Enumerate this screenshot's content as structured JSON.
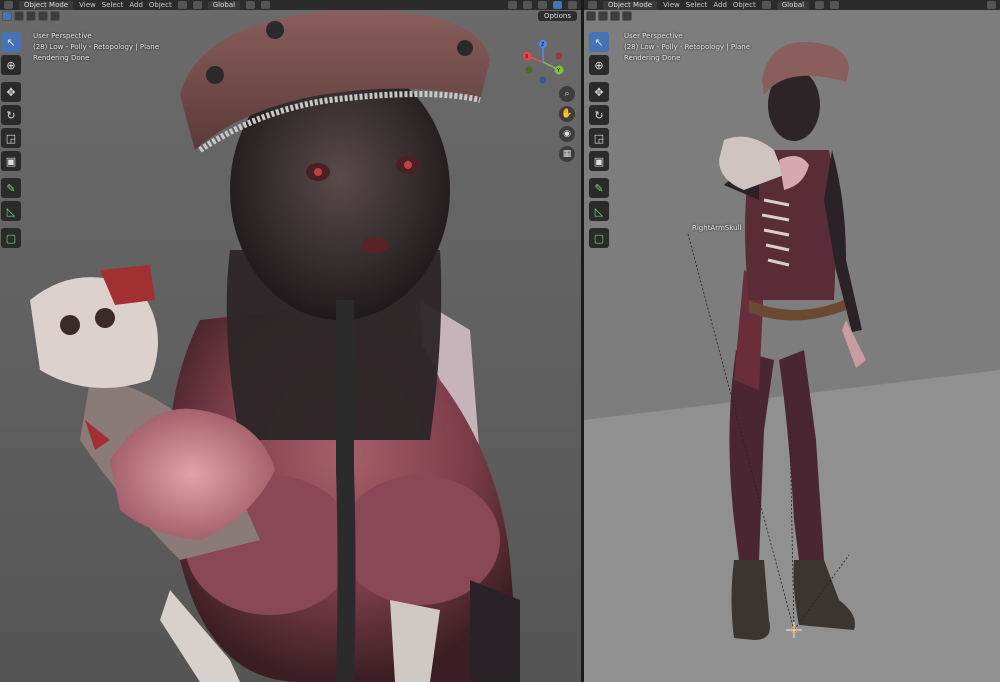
{
  "left_viewport": {
    "header": {
      "mode": "Object Mode",
      "menus": [
        "View",
        "Select",
        "Add",
        "Object"
      ],
      "transform": "Global"
    },
    "options_label": "Options",
    "overlay": {
      "perspective": "User Perspective",
      "object": "(28) Low - Polly - Retopology | Plane",
      "status": "Rendering Done"
    },
    "gizmo": {
      "axes": [
        "X",
        "Y",
        "Z"
      ],
      "colors": {
        "x": "#e34b4b",
        "y": "#7fc241",
        "z": "#4a8ef0"
      }
    },
    "nav_icons": [
      "zoom-icon",
      "hand-icon",
      "camera-icon",
      "grid-icon"
    ]
  },
  "right_viewport": {
    "header": {
      "mode": "Object Mode",
      "menus": [
        "View",
        "Select",
        "Add",
        "Object"
      ],
      "transform": "Global"
    },
    "overlay": {
      "perspective": "User Perspective",
      "object": "(28) Low - Polly - Retopology | Plane",
      "status": "Rendering Done"
    },
    "object_label": "RightArmSkull"
  },
  "toolbar_icons": [
    "cursor-select-icon",
    "cursor-3d-icon",
    "move-icon",
    "rotate-icon",
    "scale-icon",
    "transform-icon",
    "annotate-icon",
    "measure-icon",
    "add-cube-icon"
  ],
  "colors": {
    "accent": "#4772b3",
    "header_bg": "#2b2b2b",
    "viewport_bg": "#6b6b6b"
  }
}
